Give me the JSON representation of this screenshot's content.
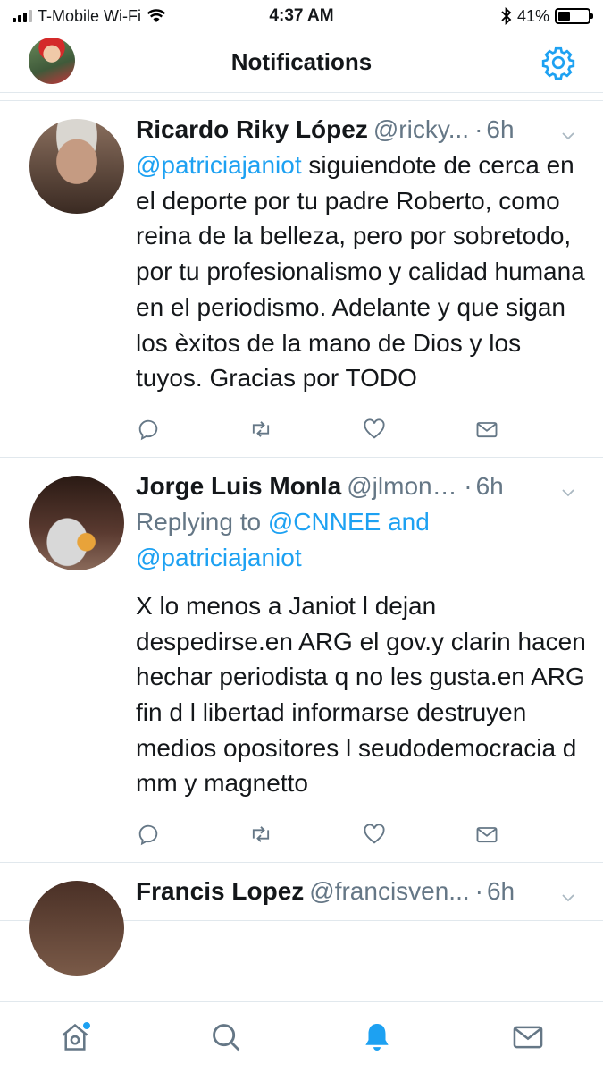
{
  "status_bar": {
    "carrier": "T-Mobile Wi-Fi",
    "time": "4:37 AM",
    "battery_text": "41%",
    "battery_level": 0.41
  },
  "header": {
    "title": "Notifications"
  },
  "colors": {
    "accent": "#1da1f2",
    "secondary_text": "#657786",
    "primary_text": "#14171a",
    "divider": "#e1e8ed"
  },
  "tweets": [
    {
      "name": "Ricardo Riky López",
      "handle": "@ricky...",
      "dot": "·",
      "time": "6h",
      "mention": "@patriciajaniot",
      "text": " siguiendote de cerca en el deporte por tu padre Roberto, como reina de la belleza, pero por sobretodo, por tu profesionalismo y calidad humana en el periodismo. Adelante y que sigan los èxitos de la mano de Dios y los tuyos. Gracias por TODO"
    },
    {
      "name": "Jorge Luis Monla",
      "handle": "@jlmonla...",
      "dot": "·",
      "time": "6h",
      "replying_prefix": "Replying to ",
      "replying_to": "@CNNEE and @patriciajaniot",
      "text": "X lo menos a Janiot l dejan despedirse.en ARG el gov.y clarin hacen hechar periodista q no les gusta.en ARG fin d l libertad informarse destruyen medios opositores l seudodemocracia d mm y magnetto"
    },
    {
      "name": "Francis Lopez",
      "handle": "@francisven...",
      "dot": "·",
      "time": "6h"
    }
  ],
  "icons": {
    "reply": "reply-icon",
    "retweet": "retweet-icon",
    "like": "heart-icon",
    "dm": "envelope-icon",
    "home": "home-icon",
    "search": "search-icon",
    "notifications": "bell-icon",
    "messages": "mail-icon"
  }
}
